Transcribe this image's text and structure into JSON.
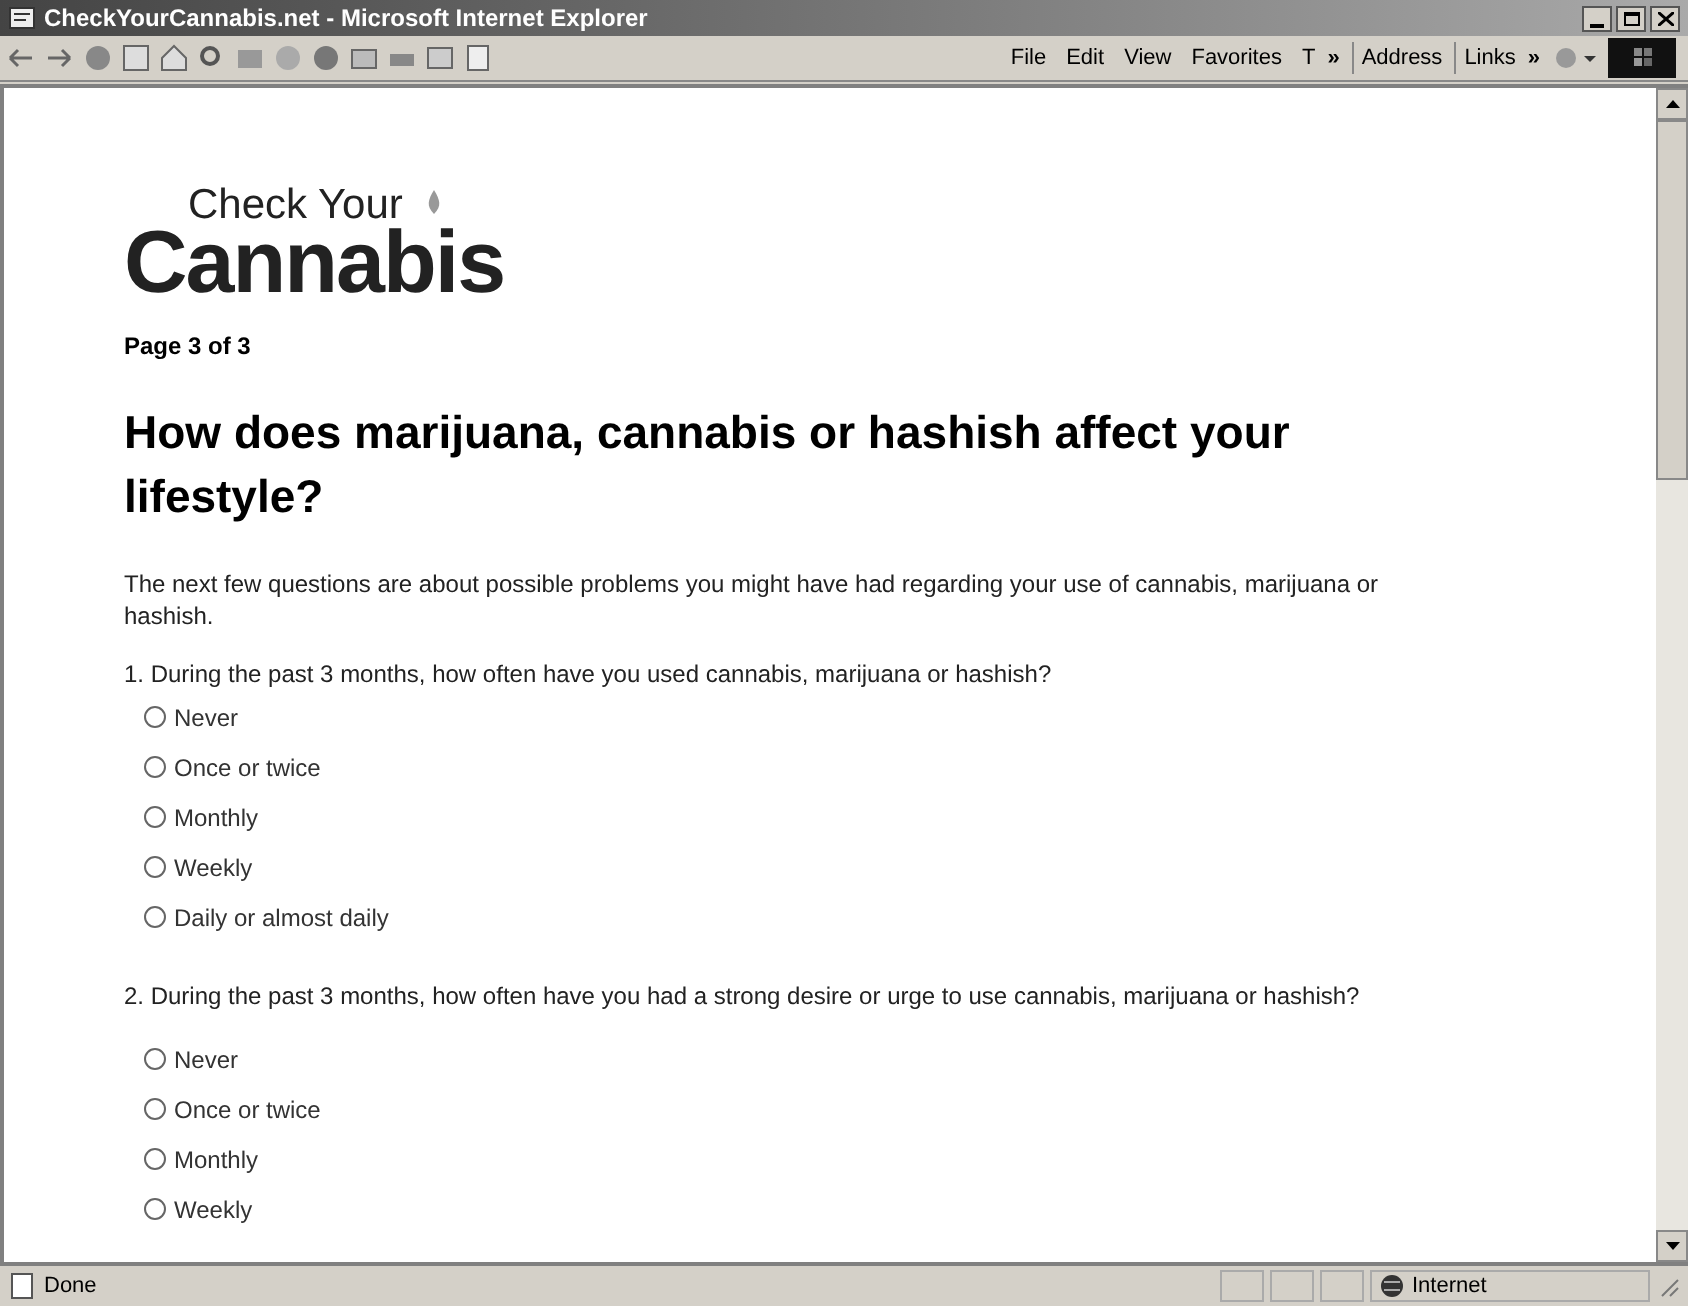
{
  "window": {
    "title": "CheckYourCannabis.net - Microsoft Internet Explorer"
  },
  "menu": [
    "File",
    "Edit",
    "View",
    "Favorites",
    "T"
  ],
  "toolbar": {
    "chevron": "»",
    "address": "Address",
    "links": "Links",
    "links_chevron": "»"
  },
  "logo": {
    "small": "Check Your",
    "big": "Cannabis"
  },
  "page_label": "Page 3 of 3",
  "heading": "How does marijuana, cannabis or hashish affect your lifestyle?",
  "intro": "The next few questions are about possible problems you might have had regarding your use of cannabis, marijuana or hashish.",
  "questions": [
    {
      "text": "1. During the past 3 months, how often have you used cannabis, marijuana or hashish?",
      "options": [
        {
          "label": "Never",
          "selected": false
        },
        {
          "label": "Once or twice",
          "selected": false
        },
        {
          "label": "Monthly",
          "selected": false
        },
        {
          "label": "Weekly",
          "selected": false
        },
        {
          "label": "Daily or almost daily",
          "selected": false
        }
      ]
    },
    {
      "text": "2. During the past 3 months, how often have you had a strong desire or urge to use cannabis, marijuana or hashish?",
      "options": [
        {
          "label": "Never",
          "selected": false
        },
        {
          "label": "Once or twice",
          "selected": false
        },
        {
          "label": "Monthly",
          "selected": false
        },
        {
          "label": "Weekly",
          "selected": false
        }
      ]
    }
  ],
  "status_bar": {
    "text": "Done",
    "zone": "Internet"
  }
}
